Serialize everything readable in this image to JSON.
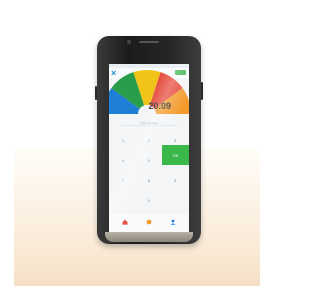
{
  "screen": {
    "topbar": {
      "close_icon": "close-icon",
      "tag_color": "#3bb84a"
    },
    "amount": "20.09",
    "pin_caption": "Input amount",
    "keypad": {
      "keys": [
        "1",
        "2",
        "3",
        "4",
        "5",
        "6",
        "7",
        "8",
        "9",
        "",
        "0"
      ],
      "ok_label": "OK",
      "ok_color": "#3bb84a"
    },
    "menu": {
      "items": [
        {
          "label": "",
          "color": "#1f7fd6"
        },
        {
          "label": "",
          "color": "#2a9d4a"
        },
        {
          "label": "",
          "color": "#f0c419"
        },
        {
          "label": "",
          "color": "#e64a3b"
        },
        {
          "label": "",
          "color": "#f39c2d"
        }
      ]
    },
    "bottom_nav": [
      "home-icon",
      "star-icon",
      "user-icon"
    ]
  },
  "colors": {
    "accent": "#1d8fd0",
    "backdrop": "#f6e0c6"
  }
}
